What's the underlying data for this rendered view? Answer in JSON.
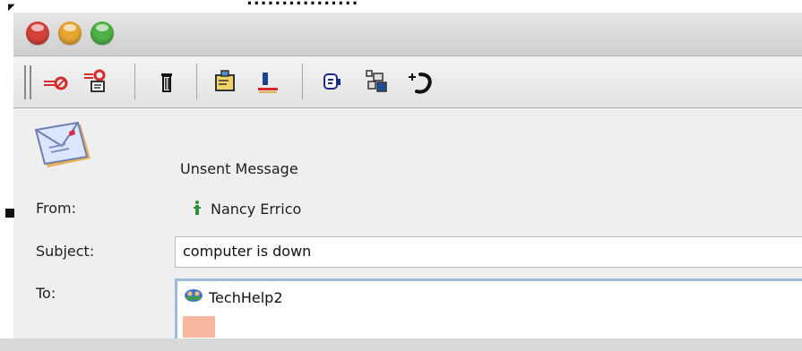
{
  "top_crop": {
    "text": "................ "
  },
  "window": {
    "status_title": "Unsent Message"
  },
  "fields": {
    "from_label": "From:",
    "from_value": "Nancy Errico",
    "subject_label": "Subject:",
    "subject_value": "computer is down",
    "to_label": "To:",
    "to_recipient": "TechHelp2"
  },
  "toolbar_items": [
    {
      "name": "remove-icon"
    },
    {
      "name": "remove-all-icon"
    },
    {
      "name": "trash-icon"
    },
    {
      "name": "address-icon"
    },
    {
      "name": "contacts-icon"
    },
    {
      "name": "message-icon"
    },
    {
      "name": "attachments-icon"
    },
    {
      "name": "phone-icon"
    }
  ],
  "colors": {
    "close": "#d6423a",
    "minimize": "#e8a531",
    "zoom": "#4fb245",
    "to_border": "#9eb8de",
    "recipient_input": "#f8b89f"
  }
}
